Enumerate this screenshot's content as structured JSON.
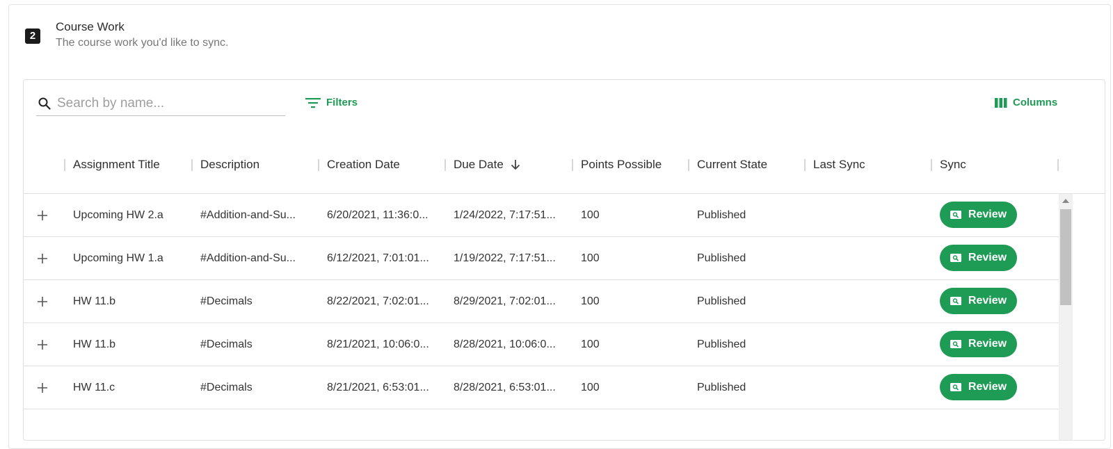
{
  "section": {
    "step": "2",
    "title": "Course Work",
    "subtitle": "The course work you'd like to sync."
  },
  "toolbar": {
    "search_placeholder": "Search by name...",
    "filters_label": "Filters",
    "columns_label": "Columns"
  },
  "columns": [
    "Assignment Title",
    "Description",
    "Creation Date",
    "Due Date",
    "Points Possible",
    "Current State",
    "Last Sync",
    "Sync"
  ],
  "sort": {
    "column": "Due Date",
    "direction": "descending"
  },
  "rows": [
    {
      "title": "Upcoming HW 2.a",
      "description": "#Addition-and-Su...",
      "created": "6/20/2021, 11:36:0...",
      "due": "1/24/2022, 7:17:51...",
      "points": "100",
      "state": "Published",
      "last_sync": "",
      "action": "Review"
    },
    {
      "title": "Upcoming HW 1.a",
      "description": "#Addition-and-Su...",
      "created": "6/12/2021, 7:01:01...",
      "due": "1/19/2022, 7:17:51...",
      "points": "100",
      "state": "Published",
      "last_sync": "",
      "action": "Review"
    },
    {
      "title": "HW 11.b",
      "description": "#Decimals",
      "created": "8/22/2021, 7:02:01...",
      "due": "8/29/2021, 7:02:01...",
      "points": "100",
      "state": "Published",
      "last_sync": "",
      "action": "Review"
    },
    {
      "title": "HW 11.b",
      "description": "#Decimals",
      "created": "8/21/2021, 10:06:0...",
      "due": "8/28/2021, 10:06:0...",
      "points": "100",
      "state": "Published",
      "last_sync": "",
      "action": "Review"
    },
    {
      "title": "HW 11.c",
      "description": "#Decimals",
      "created": "8/21/2021, 6:53:01...",
      "due": "8/28/2021, 6:53:01...",
      "points": "100",
      "state": "Published",
      "last_sync": "",
      "action": "Review"
    }
  ],
  "colors": {
    "accent": "#1e9b55",
    "badge": "#1b1b1b",
    "border": "#e0e0e0"
  },
  "icons": {
    "search": "search-icon",
    "filters": "filter-lines-icon",
    "columns": "columns-icon",
    "sort": "arrow-down-icon",
    "expand": "plus-icon",
    "review": "magnifier-doc-icon"
  }
}
